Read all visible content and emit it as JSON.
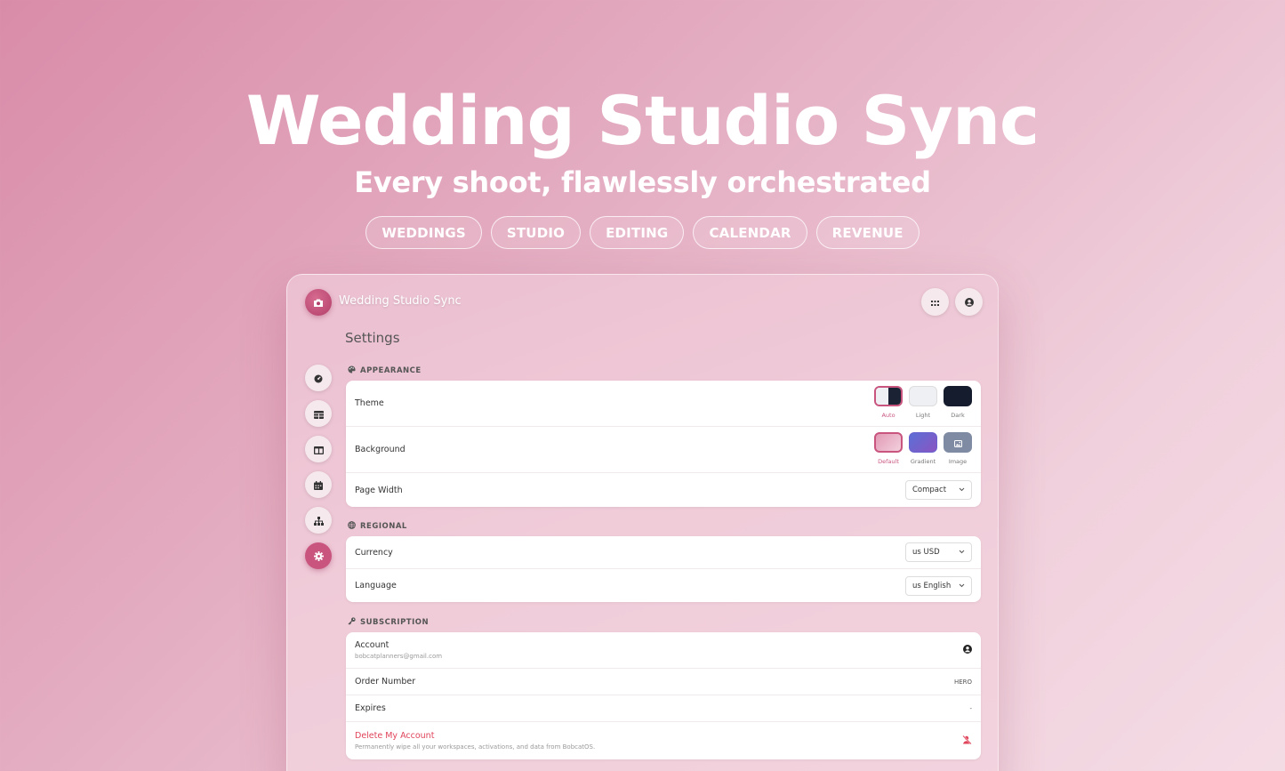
{
  "hero": {
    "title": "Wedding Studio Sync",
    "subtitle": "Every shoot, flawlessly orchestrated",
    "pills": [
      "WEDDINGS",
      "STUDIO",
      "EDITING",
      "CALENDAR",
      "REVENUE"
    ]
  },
  "app": {
    "title": "Wedding Studio Sync",
    "page_title": "Settings",
    "top_icons": [
      "apps-grid-icon",
      "user-circle-icon"
    ],
    "sidebar": [
      {
        "icon": "dashboard-icon",
        "active": false
      },
      {
        "icon": "table-icon",
        "active": false
      },
      {
        "icon": "columns-icon",
        "active": false
      },
      {
        "icon": "calendar-icon",
        "active": false
      },
      {
        "icon": "hierarchy-icon",
        "active": false
      },
      {
        "icon": "gear-icon",
        "active": true
      }
    ]
  },
  "appearance": {
    "heading": "APPEARANCE",
    "theme_label": "Theme",
    "theme_options": [
      {
        "label": "Auto",
        "selected": true
      },
      {
        "label": "Light",
        "selected": false
      },
      {
        "label": "Dark",
        "selected": false
      }
    ],
    "background_label": "Background",
    "background_options": [
      {
        "label": "Default",
        "selected": true
      },
      {
        "label": "Gradient",
        "selected": false
      },
      {
        "label": "Image",
        "selected": false
      }
    ],
    "page_width_label": "Page Width",
    "page_width_value": "Compact"
  },
  "regional": {
    "heading": "REGIONAL",
    "currency_label": "Currency",
    "currency_value": "us USD",
    "language_label": "Language",
    "language_value": "us English"
  },
  "subscription": {
    "heading": "SUBSCRIPTION",
    "account_label": "Account",
    "account_email": "bobcatplanners@gmail.com",
    "order_label": "Order Number",
    "order_value": "HERO",
    "expires_label": "Expires",
    "expires_value": "-",
    "delete_label": "Delete My Account",
    "delete_desc": "Permanently wipe all your workspaces, activations, and data from BobcatOS."
  },
  "colors": {
    "accent": "#c9557f",
    "danger": "#e0445a"
  }
}
